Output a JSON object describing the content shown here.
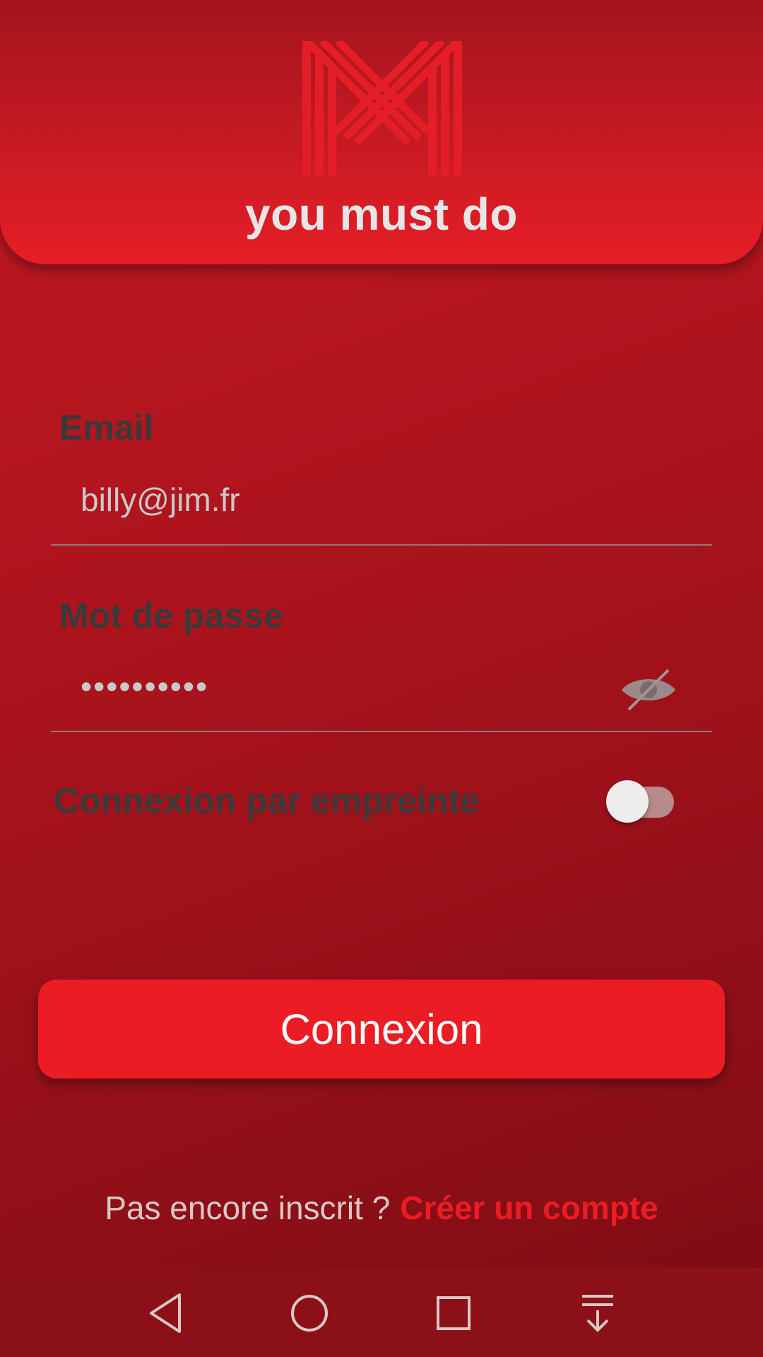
{
  "app": {
    "brand": "you must do"
  },
  "form": {
    "email_label": "Email",
    "email_value": "billy@jim.fr",
    "password_label": "Mot de passe",
    "password_value": "••••••••••",
    "fingerprint_label": "Connexion par empreinte",
    "fingerprint_enabled": false
  },
  "actions": {
    "login_label": "Connexion",
    "signup_prompt": "Pas encore inscrit ?",
    "signup_link": "Créer un compte"
  },
  "icons": {
    "logo": "m-logo-icon",
    "password_toggle": "eye-off-icon",
    "nav": [
      "back-icon",
      "home-icon",
      "recents-icon",
      "notifications-icon"
    ]
  },
  "colors": {
    "accent": "#eb1c24",
    "background": "#a1121b",
    "label": "#3a3a3a",
    "input_text": "#c9c9c9"
  }
}
